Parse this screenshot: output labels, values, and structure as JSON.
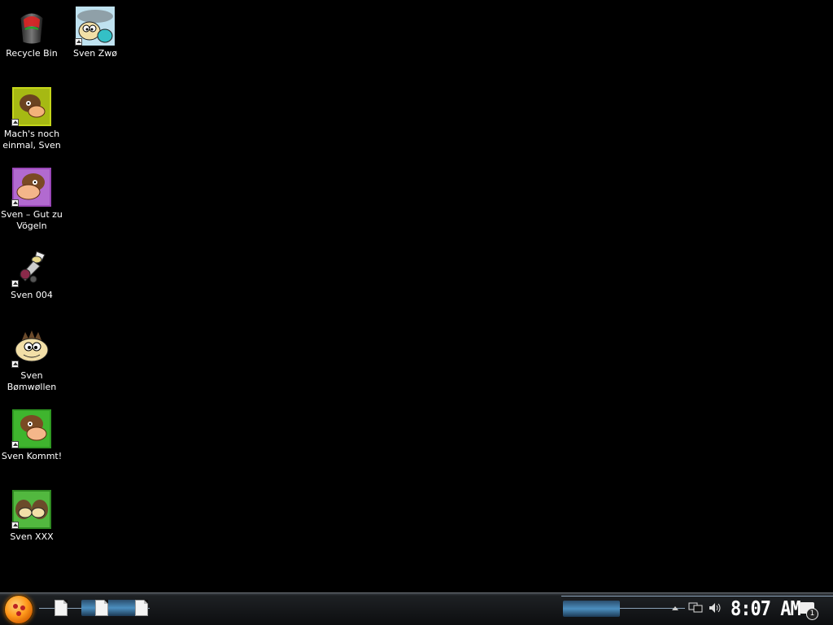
{
  "desktop": {
    "icons": [
      {
        "label": "Recycle Bin",
        "icon": "recycle-bin-icon"
      },
      {
        "label": "Sven Zwø",
        "icon": "sven-zwo-icon"
      },
      {
        "label": "Mach's noch einmal, Sven",
        "icon": "sven-game-icon"
      },
      {
        "label": "Sven – Gut zu Vögeln",
        "icon": "sven-game-icon"
      },
      {
        "label": "Sven 004",
        "icon": "sven-004-icon"
      },
      {
        "label": "Sven Bømwøllen",
        "icon": "sven-bomwollen-icon"
      },
      {
        "label": "Sven Kommt!",
        "icon": "sven-game-icon"
      },
      {
        "label": "Sven XXX",
        "icon": "sven-xxx-icon"
      }
    ]
  },
  "taskbar": {
    "clock": "8:07 AM",
    "notification_count": "1"
  },
  "colors": {
    "desktop_bg": "#000000",
    "taskbar_accent": "#4c8fbf",
    "start_orb": "#ff9a1c"
  }
}
